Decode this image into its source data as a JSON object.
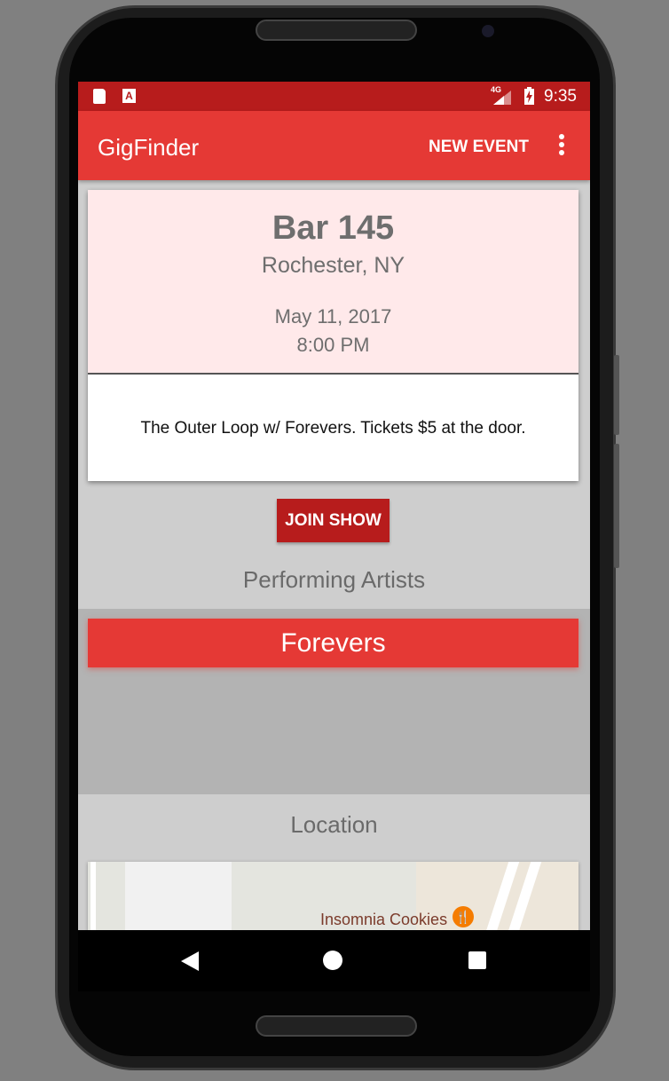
{
  "status_bar": {
    "network": "4G",
    "time": "9:35"
  },
  "app_bar": {
    "title": "GigFinder",
    "new_event_label": "NEW EVENT"
  },
  "event": {
    "venue": "Bar 145",
    "city": "Rochester, NY",
    "date": "May 11, 2017",
    "time": "8:00 PM",
    "description": "The Outer Loop w/ Forevers. Tickets $5 at the door."
  },
  "join_label": "JOIN SHOW",
  "artists_heading": "Performing Artists",
  "artists": [
    {
      "name": "Forevers"
    }
  ],
  "location_heading": "Location",
  "map": {
    "place_label": "Insomnia Cookies"
  }
}
